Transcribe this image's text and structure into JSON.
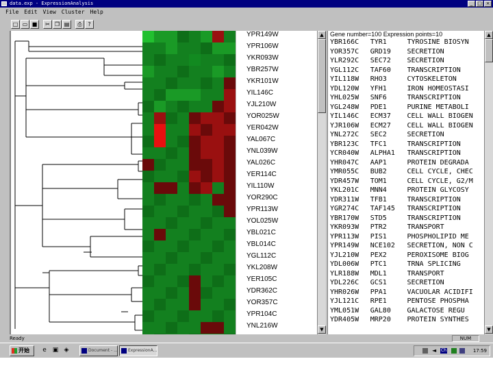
{
  "window": {
    "title": "data.exp - ExpressionAnalysis",
    "min_label": "_",
    "max_label": "□",
    "close_label": "×"
  },
  "menu": [
    "File",
    "Edit",
    "View",
    "Cluster",
    "Help"
  ],
  "toolbar": [
    {
      "icon": "new-file-icon",
      "glyph": "□"
    },
    {
      "icon": "open-folder-icon",
      "glyph": "▭"
    },
    {
      "icon": "save-icon",
      "glyph": "■"
    },
    {
      "icon": "cut-icon",
      "glyph": "✂"
    },
    {
      "icon": "copy-icon",
      "glyph": "❐"
    },
    {
      "icon": "paste-icon",
      "glyph": "▤"
    },
    {
      "icon": "print-icon",
      "glyph": "⎙"
    },
    {
      "icon": "help-icon",
      "glyph": "?"
    }
  ],
  "colors": {
    "green_dark": "#0a5a12",
    "green_mid": "#128a20",
    "green_bright": "#22c030",
    "red_dark": "#6a0a0a",
    "red_mid": "#9a1010",
    "red_bright": "#e81010"
  },
  "heatmap": {
    "levels_note": "",
    "rows": [
      [
        5,
        3,
        3,
        2,
        2,
        3,
        -2,
        2
      ],
      [
        2,
        2,
        3,
        2,
        2,
        2,
        3,
        3
      ],
      [
        2,
        2,
        2,
        2,
        1,
        2,
        2,
        2
      ],
      [
        3,
        2,
        2,
        2,
        2,
        2,
        3,
        2
      ],
      [
        2,
        2,
        2,
        2,
        2,
        2,
        2,
        -1
      ],
      [
        2,
        2,
        3,
        3,
        3,
        2,
        2,
        -2
      ],
      [
        2,
        3,
        2,
        2,
        2,
        2,
        -1,
        -2
      ],
      [
        2,
        -3,
        2,
        2,
        -1,
        -2,
        -2,
        -1
      ],
      [
        2,
        -4,
        2,
        2,
        -2,
        -1,
        -2,
        -2
      ],
      [
        2,
        -5,
        2,
        2,
        -1,
        -2,
        -2,
        -1
      ],
      [
        2,
        2,
        2,
        2,
        -1,
        -2,
        -2,
        -1
      ],
      [
        -1,
        2,
        2,
        2,
        -1,
        -1,
        -2,
        -1
      ],
      [
        2,
        2,
        2,
        2,
        -2,
        -1,
        -2,
        -1
      ],
      [
        2,
        -1,
        -1,
        2,
        -1,
        -2,
        2,
        -1
      ],
      [
        2,
        2,
        2,
        2,
        2,
        2,
        -1,
        -1
      ],
      [
        2,
        2,
        2,
        2,
        2,
        2,
        2,
        -1
      ],
      [
        2,
        2,
        2,
        2,
        2,
        2,
        2,
        2
      ],
      [
        2,
        -1,
        2,
        2,
        2,
        2,
        2,
        2
      ],
      [
        2,
        2,
        2,
        2,
        2,
        2,
        2,
        2
      ],
      [
        2,
        2,
        2,
        2,
        2,
        2,
        2,
        2
      ],
      [
        2,
        2,
        2,
        2,
        2,
        2,
        2,
        2
      ],
      [
        2,
        2,
        2,
        2,
        -1,
        2,
        2,
        2
      ],
      [
        2,
        2,
        2,
        2,
        -1,
        2,
        2,
        2
      ],
      [
        2,
        2,
        2,
        2,
        -1,
        2,
        2,
        2
      ],
      [
        2,
        2,
        2,
        2,
        2,
        2,
        2,
        2
      ],
      [
        2,
        2,
        2,
        2,
        2,
        -1,
        -1,
        2
      ],
      [
        2,
        2,
        2,
        2,
        2,
        2,
        2,
        2
      ]
    ]
  },
  "gene_labels": [
    "YPR149W",
    "YPR106W",
    "YKR093W",
    "YBR257W",
    "YKR101W",
    "YIL146C",
    "YJL210W",
    "YOR025W",
    "YER042W",
    "YAL067C",
    "YNL039W",
    "YAL026C",
    "YER114C",
    "YIL110W",
    "YOR290C",
    "YPR113W",
    "YOL025W",
    "YBL021C",
    "YBL014C",
    "YGL112C",
    "YKL208W",
    "YER105C",
    "YDR362C",
    "YOR357C",
    "YPR104C",
    "YNL216W"
  ],
  "info": {
    "header": "Gene number=100   Expression points=10",
    "rows": [
      [
        "YBR166C",
        "TYR1",
        "TYROSINE BIOSYN"
      ],
      [
        "YOR357C",
        "GRD19",
        "SECRETION"
      ],
      [
        "YLR292C",
        "SEC72",
        "SECRETION"
      ],
      [
        "YGL112C",
        "TAF60",
        "TRANSCRIPTION"
      ],
      [
        "YIL118W",
        "RHO3",
        "CYTOSKELETON"
      ],
      [
        "YDL120W",
        "YFH1",
        "IRON HOMEOSTASI"
      ],
      [
        "YHL025W",
        "SNF6",
        "TRANSCRIPTION"
      ],
      [
        "YGL248W",
        "PDE1",
        "PURINE METABOLI"
      ],
      [
        "YIL146C",
        "ECM37",
        "CELL WALL BIOGEN"
      ],
      [
        "YJR106W",
        "ECM27",
        "CELL WALL BIOGEN"
      ],
      [
        "YNL272C",
        "SEC2",
        "SECRETION"
      ],
      [
        "YBR123C",
        "TFC1",
        "TRANSCRIPTION"
      ],
      [
        "YCR040W",
        "ALPHA1",
        "TRANSCRIPTION"
      ],
      [
        "YHR047C",
        "AAP1",
        "PROTEIN DEGRADA"
      ],
      [
        "YMR055C",
        "BUB2",
        "CELL CYCLE, CHEC"
      ],
      [
        "YDR457W",
        "TOM1",
        "CELL CYCLE, G2/M"
      ],
      [
        "YKL201C",
        "MNN4",
        "PROTEIN GLYCOSY"
      ],
      [
        "YDR311W",
        "TFB1",
        "TRANSCRIPTION"
      ],
      [
        "YGR274C",
        "TAF145",
        "TRANSCRIPTION"
      ],
      [
        "YBR170W",
        "STD5",
        "TRANSCRIPTION"
      ],
      [
        "YKR093W",
        "PTR2",
        "TRANSPORT"
      ],
      [
        "YPR113W",
        "PIS1",
        "PHOSPHOLIPID ME"
      ],
      [
        "YPR149W",
        "NCE102",
        "SECRETION, NON C"
      ],
      [
        "YJL210W",
        "PEX2",
        "PEROXISOME BIOG"
      ],
      [
        "YDL006W",
        "PTC1",
        "TRNA SPLICING"
      ],
      [
        "YLR188W",
        "MDL1",
        "TRANSPORT"
      ],
      [
        "YDL226C",
        "GCS1",
        "SECRETION"
      ],
      [
        "YHR026W",
        "PPA1",
        "VACUOLAR ACIDIFI"
      ],
      [
        "YJL121C",
        "RPE1",
        "PENTOSE PHOSPHA"
      ],
      [
        "YML051W",
        "GAL80",
        "GALACTOSE REGU"
      ],
      [
        "YDR405W",
        "MRP20",
        "PROTEIN SYNTHES"
      ]
    ]
  },
  "status": {
    "left": "Ready",
    "right": "NUM"
  },
  "taskbar": {
    "start_label": "开始",
    "tasks": [
      "Document - ...",
      "ExpressionA..."
    ],
    "clock": "17:59"
  },
  "tree": {
    "segments": [
      [
        20,
        60,
        20,
        480
      ],
      [
        20,
        60,
        40,
        60
      ],
      [
        40,
        60,
        40,
        75
      ],
      [
        40,
        68,
        208,
        68
      ],
      [
        40,
        75,
        208,
        75
      ],
      [
        20,
        140,
        36,
        140
      ],
      [
        36,
        85,
        36,
        200
      ],
      [
        36,
        85,
        150,
        85
      ],
      [
        150,
        85,
        150,
        110
      ],
      [
        150,
        95,
        208,
        95
      ],
      [
        150,
        110,
        208,
        110
      ],
      [
        36,
        125,
        180,
        125
      ],
      [
        180,
        120,
        180,
        130
      ],
      [
        180,
        120,
        208,
        120
      ],
      [
        180,
        130,
        208,
        130
      ],
      [
        36,
        160,
        200,
        160
      ],
      [
        200,
        150,
        200,
        168
      ],
      [
        200,
        150,
        208,
        150
      ],
      [
        200,
        168,
        208,
        168
      ],
      [
        36,
        200,
        190,
        200
      ],
      [
        190,
        180,
        190,
        225
      ],
      [
        190,
        180,
        208,
        180
      ],
      [
        190,
        225,
        208,
        225
      ],
      [
        190,
        200,
        208,
        200
      ],
      [
        20,
        300,
        60,
        300
      ],
      [
        60,
        240,
        60,
        360
      ],
      [
        60,
        240,
        200,
        240
      ],
      [
        200,
        235,
        200,
        250
      ],
      [
        200,
        235,
        208,
        235
      ],
      [
        200,
        250,
        208,
        250
      ],
      [
        60,
        275,
        170,
        275
      ],
      [
        170,
        262,
        170,
        290
      ],
      [
        170,
        262,
        208,
        262
      ],
      [
        170,
        290,
        208,
        290
      ],
      [
        60,
        320,
        180,
        320
      ],
      [
        180,
        305,
        180,
        335
      ],
      [
        180,
        305,
        208,
        305
      ],
      [
        180,
        335,
        208,
        335
      ],
      [
        60,
        360,
        130,
        360
      ],
      [
        130,
        345,
        130,
        375
      ],
      [
        130,
        345,
        208,
        345
      ],
      [
        130,
        375,
        208,
        375
      ],
      [
        20,
        420,
        70,
        420
      ],
      [
        70,
        395,
        70,
        470
      ],
      [
        70,
        395,
        200,
        395
      ],
      [
        200,
        388,
        200,
        402
      ],
      [
        200,
        388,
        208,
        388
      ],
      [
        200,
        402,
        208,
        402
      ],
      [
        70,
        430,
        190,
        430
      ],
      [
        190,
        420,
        190,
        440
      ],
      [
        190,
        420,
        208,
        420
      ],
      [
        190,
        440,
        208,
        440
      ],
      [
        70,
        470,
        195,
        470
      ],
      [
        195,
        460,
        195,
        482
      ],
      [
        195,
        460,
        208,
        460
      ],
      [
        195,
        482,
        208,
        482
      ],
      [
        120,
        368,
        132,
        368
      ],
      [
        60,
        398,
        70,
        398
      ],
      [
        175,
        455,
        185,
        455
      ]
    ]
  }
}
